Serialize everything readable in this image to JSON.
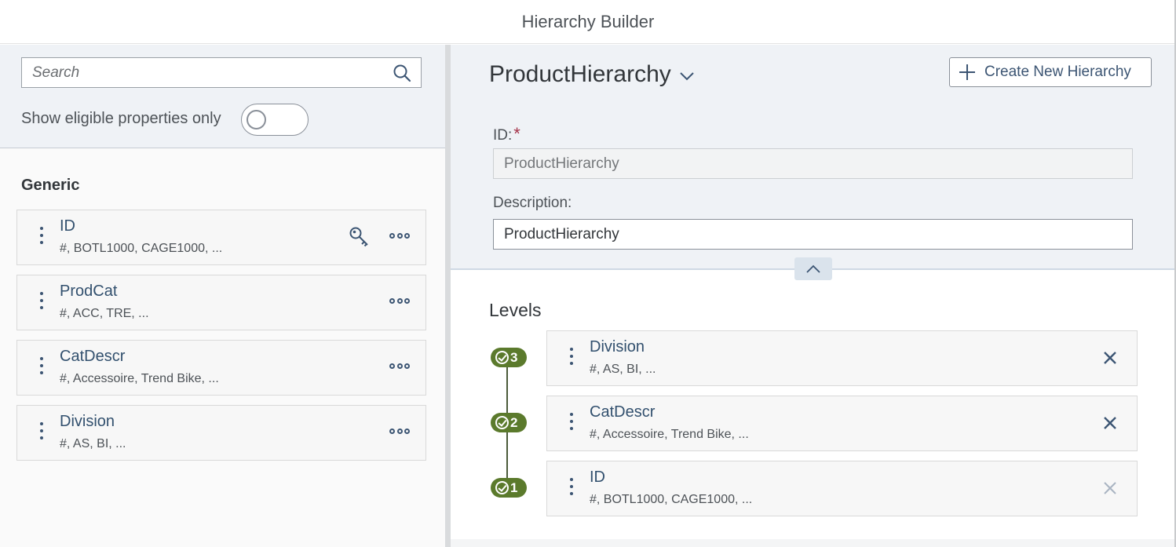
{
  "app": {
    "title": "Hierarchy Builder"
  },
  "left_panel": {
    "search": {
      "placeholder": "Search",
      "value": ""
    },
    "eligible_toggle": {
      "label": "Show eligible properties only",
      "on": false
    },
    "group": {
      "title": "Generic",
      "properties": [
        {
          "name": "ID",
          "values": "#, BOTL1000, CAGE1000, ...",
          "key_icon": "key-icon",
          "menu_icon": "more-icon"
        },
        {
          "name": "ProdCat",
          "values": "#, ACC, TRE, ...",
          "menu_icon": "more-icon"
        },
        {
          "name": "CatDescr",
          "values": "#, Accessoire, Trend Bike, ...",
          "menu_icon": "more-icon"
        },
        {
          "name": "Division",
          "values": "#, AS, BI, ...",
          "menu_icon": "more-icon"
        }
      ]
    }
  },
  "right_panel": {
    "hierarchy_title": "ProductHierarchy",
    "create_button": {
      "label": "Create New Hierarchy",
      "icon": "plus-icon"
    },
    "id_field": {
      "label": "ID:",
      "required_marker": "*",
      "value": "ProductHierarchy"
    },
    "description_field": {
      "label": "Description:",
      "value": "ProductHierarchy"
    },
    "levels": {
      "title": "Levels",
      "items": [
        {
          "badge": "3",
          "name": "Division",
          "values": "#, AS, BI, ...",
          "removable": true
        },
        {
          "badge": "2",
          "name": "CatDescr",
          "values": "#, Accessoire, Trend Bike, ...",
          "removable": true
        },
        {
          "badge": "1",
          "name": "ID",
          "values": "#, BOTL1000, CAGE1000, ...",
          "removable": false
        }
      ]
    }
  },
  "colors": {
    "accent": "#3c5573",
    "level_badge": "#5b7a2c",
    "required": "#a5344a",
    "header_bg": "#eff2f6"
  }
}
